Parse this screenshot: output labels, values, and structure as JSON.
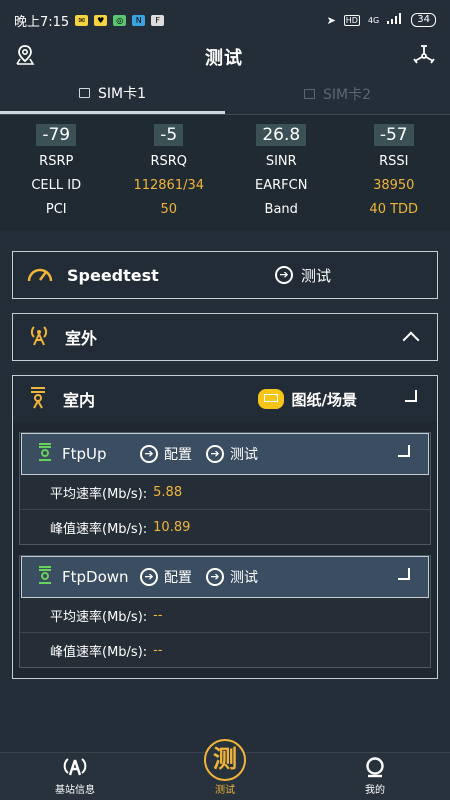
{
  "status_bar": {
    "time": "晚上7:15",
    "net": "4G",
    "battery": "34"
  },
  "header": {
    "title": "测试"
  },
  "tabs": [
    {
      "label": "SIM卡1"
    },
    {
      "label": "SIM卡2"
    }
  ],
  "metrics": {
    "labels_row1": [
      "RSRP",
      "RSRQ",
      "SINR",
      "RSSI"
    ],
    "values_row1": [
      "-79",
      "-5",
      "26.8",
      "-57"
    ],
    "row2": [
      {
        "label": "CELL ID",
        "value": "112861/34"
      },
      {
        "label": "EARFCN",
        "value": "38950"
      }
    ],
    "row3": [
      {
        "label": "PCI",
        "value": "50"
      },
      {
        "label": "Band",
        "value": "40 TDD"
      }
    ]
  },
  "speedtest": {
    "label": "Speedtest",
    "action": "测试"
  },
  "outdoor": {
    "label": "室外"
  },
  "indoor": {
    "label": "室内",
    "map_label": "图纸/场景"
  },
  "ftp_up": {
    "label": "FtpUp",
    "config": "配置",
    "test": "测试",
    "avg_label": "平均速率(Mb/s):",
    "avg_value": "5.88",
    "peak_label": "峰值速率(Mb/s):",
    "peak_value": "10.89"
  },
  "ftp_down": {
    "label": "FtpDown",
    "config": "配置",
    "test": "测试",
    "avg_label": "平均速率(Mb/s):",
    "avg_value": "--",
    "peak_label": "峰值速率(Mb/s):",
    "peak_value": "--"
  },
  "bottom_nav": [
    {
      "label": "基站信息",
      "icon": "antenna-icon"
    },
    {
      "label": "测试",
      "icon": "test-icon",
      "glyph": "测"
    },
    {
      "label": "我的",
      "icon": "profile-icon"
    }
  ],
  "colors": {
    "accent": "#f0b43a",
    "background": "#232e38",
    "value_bg": "#3b5156",
    "sub_header": "#3a4d61"
  }
}
